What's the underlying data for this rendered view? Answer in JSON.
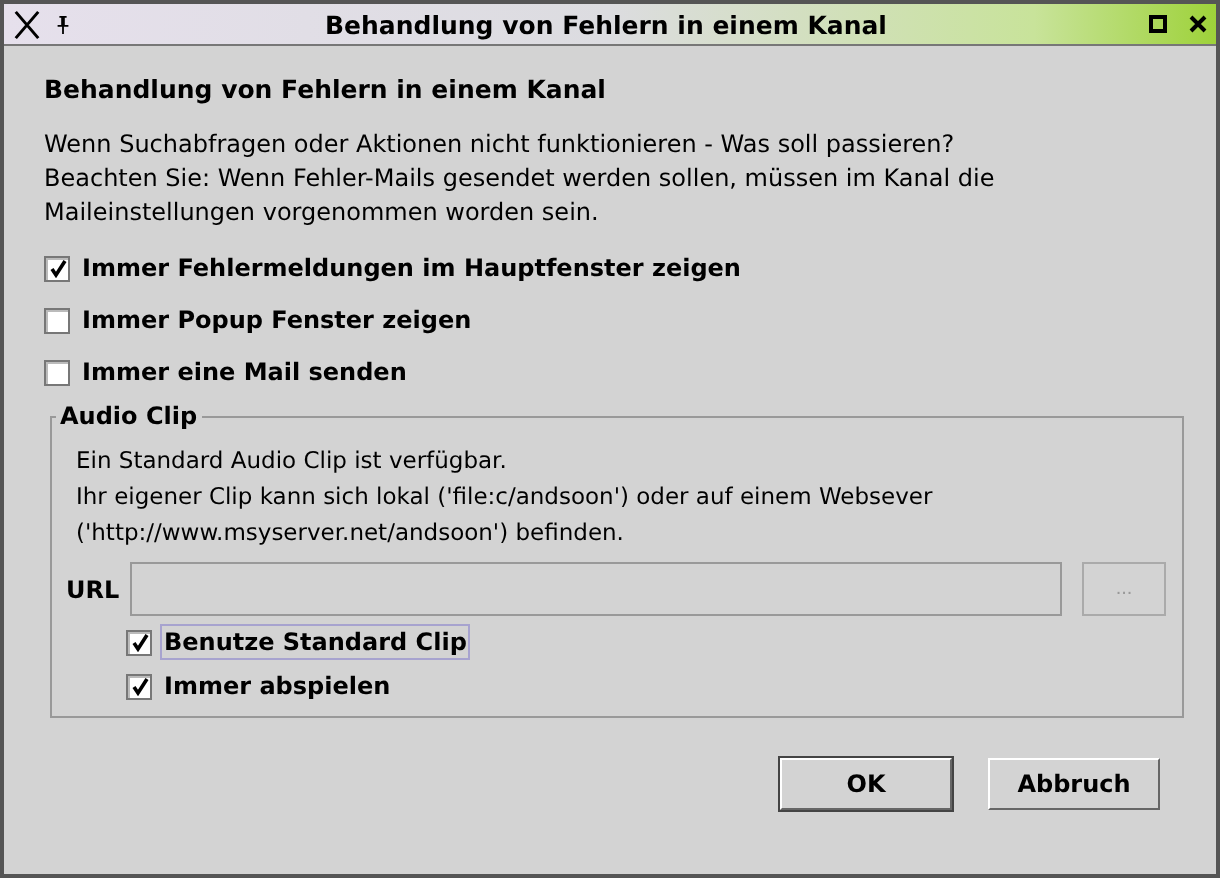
{
  "window": {
    "title": "Behandlung von Fehlern in einem Kanal"
  },
  "heading": "Behandlung von Fehlern in einem Kanal",
  "description": [
    "Wenn Suchabfragen oder Aktionen nicht funktionieren - Was soll passieren?",
    "Beachten Sie: Wenn Fehler-Mails gesendet werden sollen, müssen im Kanal die Maileinstellungen vorgenommen worden sein."
  ],
  "options": [
    {
      "label": "Immer Fehlermeldungen im Hauptfenster zeigen",
      "checked": true
    },
    {
      "label": "Immer Popup Fenster zeigen",
      "checked": false
    },
    {
      "label": "Immer eine Mail senden",
      "checked": false
    }
  ],
  "audio_clip": {
    "title": "Audio Clip",
    "info": [
      "Ein Standard Audio Clip ist verfügbar.",
      "Ihr eigener Clip kann sich lokal ('file:c/andsoon') oder auf einem Websever ('http://www.msyserver.net/andsoon') befinden."
    ],
    "url": {
      "label": "URL",
      "disabled": true
    },
    "browse_button": {
      "label": "...",
      "disabled": true
    },
    "options": [
      {
        "label": "Benutze Standard Clip",
        "checked": true,
        "focused": true
      },
      {
        "label": "Immer abspielen",
        "checked": true,
        "focused": false
      }
    ]
  },
  "buttons": [
    {
      "label": "OK",
      "default": true
    },
    {
      "label": "Abbruch",
      "default": false
    }
  ]
}
